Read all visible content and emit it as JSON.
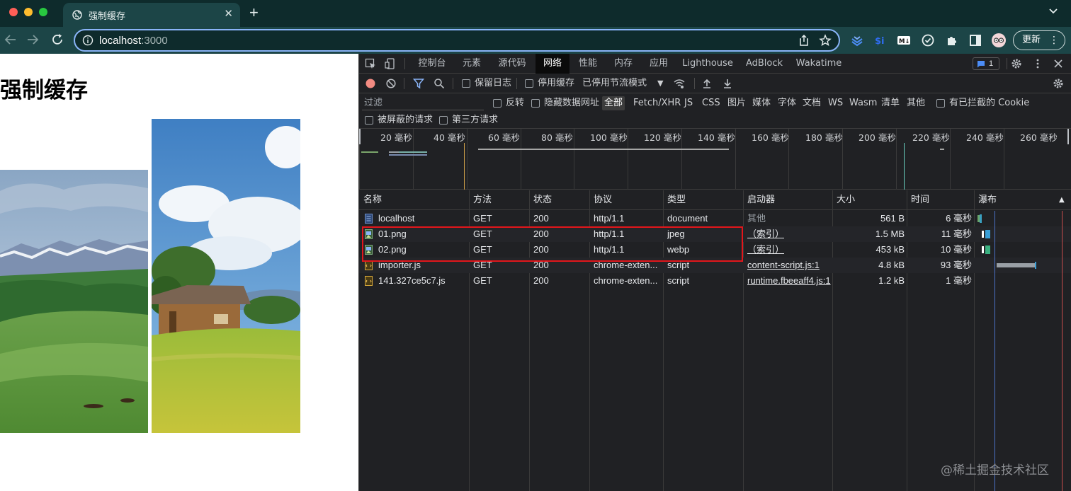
{
  "browser": {
    "tab_title": "强制缓存",
    "url_host": "localhost",
    "url_port": ":3000",
    "update_label": "更新",
    "menu_glyph": "⋮"
  },
  "page": {
    "heading": "强制缓存"
  },
  "devtools": {
    "tabs": [
      "控制台",
      "元素",
      "源代码",
      "网络",
      "性能",
      "内存",
      "应用",
      "Lighthouse",
      "AdBlock",
      "Wakatime"
    ],
    "active_tab": "网络",
    "message_count": "1",
    "toolbar": {
      "preserve_log": "保留日志",
      "disable_cache": "停用缓存",
      "throttling": "已停用节流模式"
    },
    "filter": {
      "placeholder": "过滤",
      "invert": "反转",
      "hide_data_urls": "隐藏数据网址",
      "types": [
        "全部",
        "Fetch/XHR",
        "JS",
        "CSS",
        "图片",
        "媒体",
        "字体",
        "文档",
        "WS",
        "Wasm",
        "清单",
        "其他"
      ],
      "active_type": "全部",
      "blocked_cookies": "有已拦截的 Cookie",
      "blocked_requests": "被屏蔽的请求",
      "third_party": "第三方请求"
    },
    "timeline_ticks": [
      "20 毫秒",
      "40 毫秒",
      "60 毫秒",
      "80 毫秒",
      "100 毫秒",
      "120 毫秒",
      "140 毫秒",
      "160 毫秒",
      "180 毫秒",
      "200 毫秒",
      "220 毫秒",
      "240 毫秒",
      "260 毫秒"
    ],
    "columns": [
      "名称",
      "方法",
      "状态",
      "协议",
      "类型",
      "启动器",
      "大小",
      "时间",
      "瀑布"
    ],
    "requests": [
      {
        "name": "localhost",
        "method": "GET",
        "status": "200",
        "protocol": "http/1.1",
        "type": "document",
        "initiator": "其他",
        "size": "561 B",
        "time": "6 毫秒",
        "icon": "document-icon"
      },
      {
        "name": "01.png",
        "method": "GET",
        "status": "200",
        "protocol": "http/1.1",
        "type": "jpeg",
        "initiator": "（索引）",
        "size": "1.5 MB",
        "time": "11 毫秒",
        "icon": "image-icon"
      },
      {
        "name": "02.png",
        "method": "GET",
        "status": "200",
        "protocol": "http/1.1",
        "type": "webp",
        "initiator": "（索引）",
        "size": "453 kB",
        "time": "10 毫秒",
        "icon": "image-icon"
      },
      {
        "name": "importer.js",
        "method": "GET",
        "status": "200",
        "protocol": "chrome-exten...",
        "type": "script",
        "initiator": "content-script.js:1",
        "size": "4.8 kB",
        "time": "93 毫秒",
        "icon": "script-icon"
      },
      {
        "name": "141.327ce5c7.js",
        "method": "GET",
        "status": "200",
        "protocol": "chrome-exten...",
        "type": "script",
        "initiator": "runtime.fbeeaff4.js:1",
        "size": "1.2 kB",
        "time": "1 毫秒",
        "icon": "script-icon"
      }
    ]
  },
  "watermark": "@稀土掘金技术社区",
  "colors": {
    "tab_strip": "#0e2b2c",
    "toolbar": "#1c4547",
    "devtools_bg": "#202124",
    "highlight_box": "#e3161b",
    "record_button": "#f28b82"
  }
}
